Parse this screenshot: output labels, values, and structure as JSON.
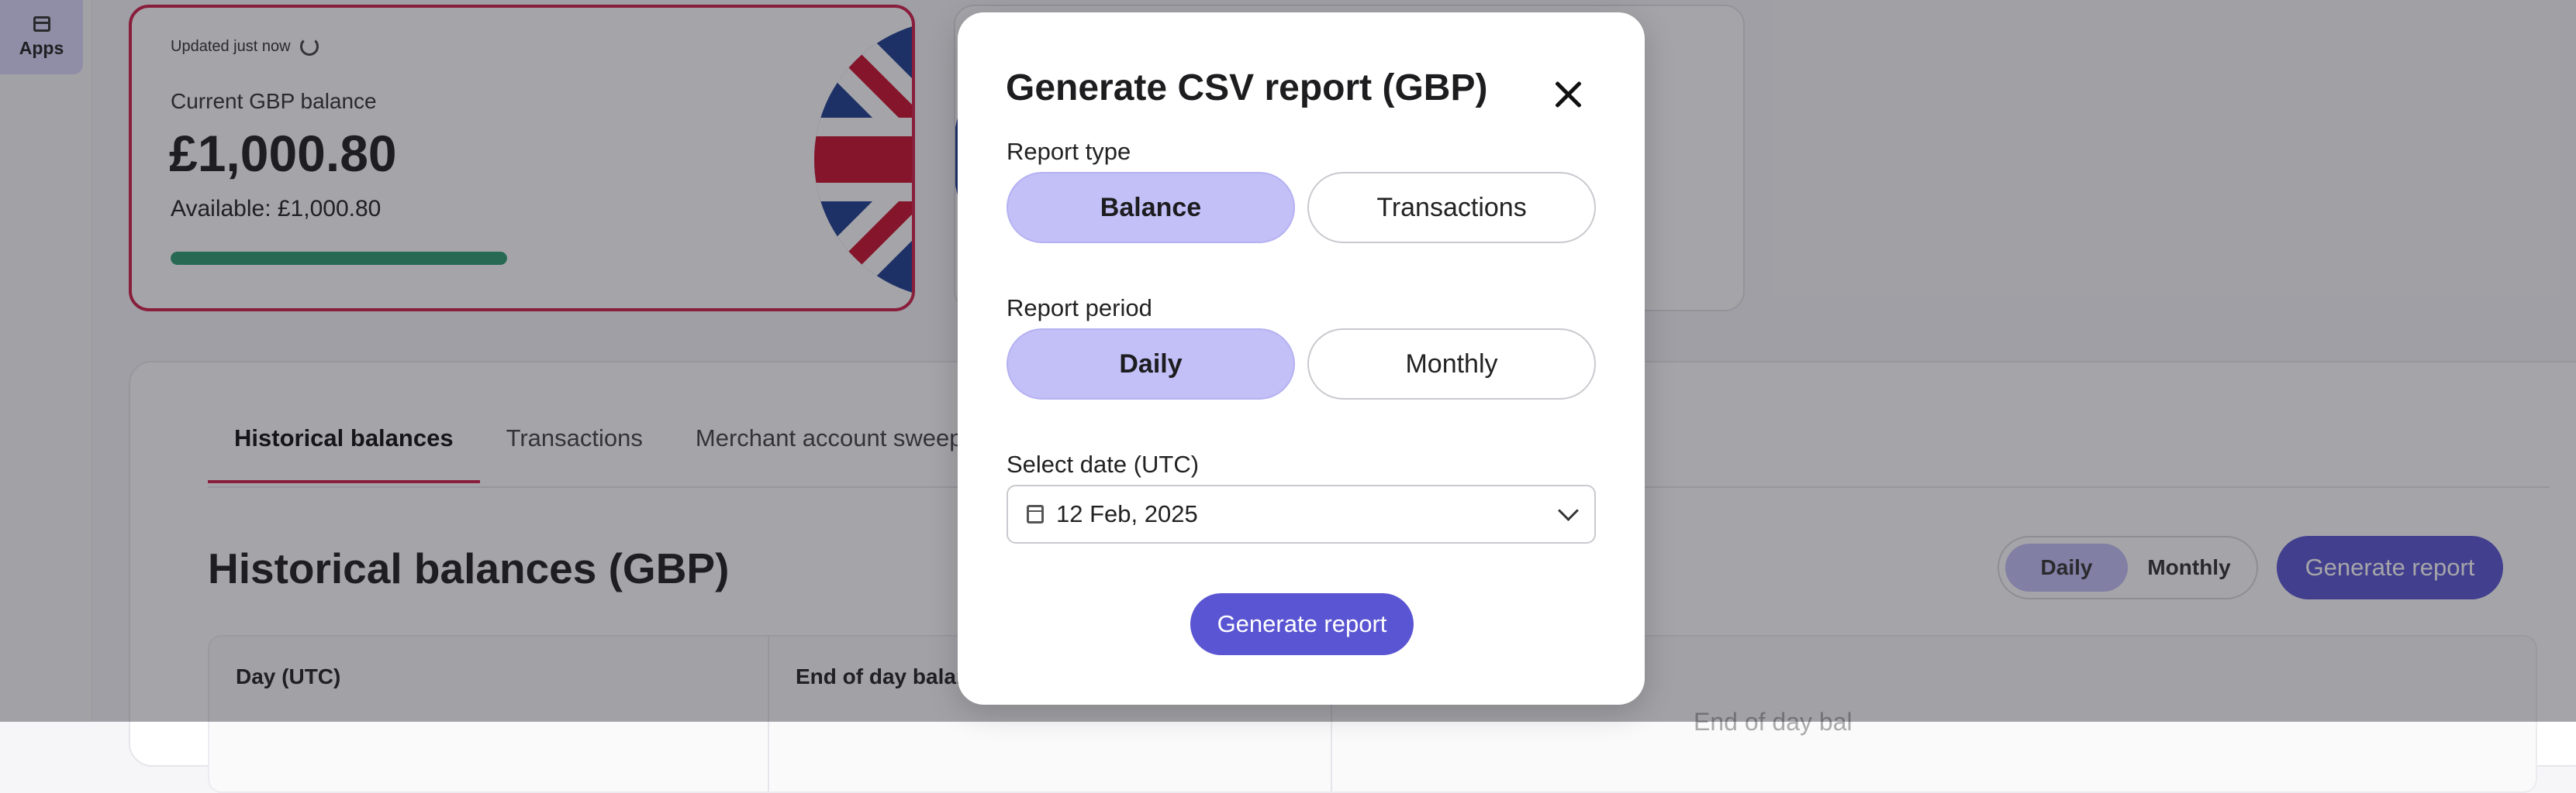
{
  "sidebar": {
    "apps_label": "Apps"
  },
  "gbp_card": {
    "updated": "Updated just now",
    "balance_label": "Current GBP balance",
    "balance_value": "£1,000.80",
    "available": "Available: £1,000.80",
    "available_fraction": 1.0
  },
  "tabs": [
    {
      "label": "Historical balances"
    },
    {
      "label": "Transactions"
    },
    {
      "label": "Merchant account sweepi"
    }
  ],
  "history": {
    "title": "Historical balances (GBP)",
    "toggle": [
      "Daily",
      "Monthly"
    ],
    "generate_label": "Generate report",
    "columns": [
      "Day (UTC)",
      "End of day balan"
    ],
    "eod_hint": "End of day bal"
  },
  "modal": {
    "title": "Generate CSV report (GBP)",
    "report_type_label": "Report type",
    "report_type_options": [
      "Balance",
      "Transactions"
    ],
    "report_period_label": "Report period",
    "report_period_options": [
      "Daily",
      "Monthly"
    ],
    "date_label": "Select date (UTC)",
    "date_value": "12 Feb, 2025",
    "generate_label": "Generate report"
  },
  "colors": {
    "accent": "#5a55d2",
    "selected": "#c3c0f7",
    "brand_red": "#d11f4a",
    "progress": "#2e9b6f"
  }
}
